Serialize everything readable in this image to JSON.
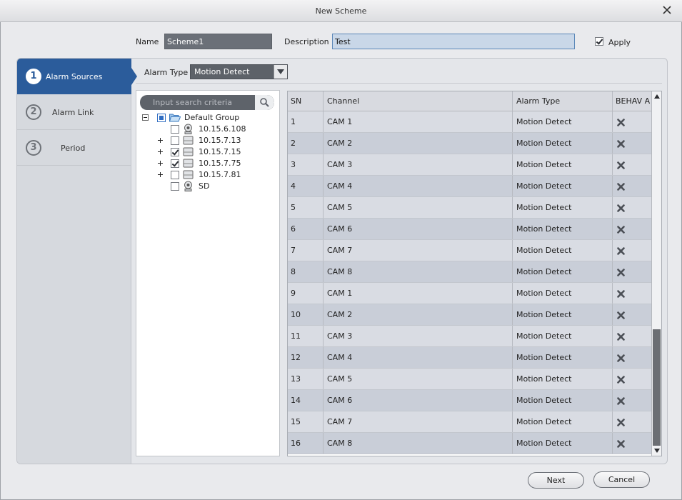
{
  "window": {
    "title": "New Scheme"
  },
  "form": {
    "name_label": "Name",
    "name_value": "Scheme1",
    "description_label": "Description",
    "description_value": "Test",
    "apply_label": "Apply",
    "apply_checked": true
  },
  "steps": [
    {
      "num": "1",
      "label": "Alarm Sources",
      "active": true
    },
    {
      "num": "2",
      "label": "Alarm Link",
      "active": false
    },
    {
      "num": "3",
      "label": "Period",
      "active": false
    }
  ],
  "alarm_type": {
    "label": "Alarm Type",
    "value": "Motion Detect"
  },
  "tree": {
    "search_placeholder": "Input search criteria",
    "group": "Default Group",
    "devices": [
      {
        "label": "10.15.6.108",
        "expandable": false,
        "checked": false,
        "icon": "camera-icon"
      },
      {
        "label": "10.15.7.13",
        "expandable": true,
        "checked": false,
        "icon": "nvr-device-icon"
      },
      {
        "label": "10.15.7.15",
        "expandable": true,
        "checked": true,
        "icon": "nvr-device-icon"
      },
      {
        "label": "10.15.7.75",
        "expandable": true,
        "checked": true,
        "icon": "nvr-device-icon"
      },
      {
        "label": "10.15.7.81",
        "expandable": true,
        "checked": false,
        "icon": "nvr-device-icon"
      },
      {
        "label": "SD",
        "expandable": false,
        "checked": false,
        "icon": "camera-icon"
      }
    ]
  },
  "table": {
    "columns": [
      "SN",
      "Channel",
      "Alarm Type",
      "BEHAV A"
    ],
    "rows": [
      [
        "1",
        "CAM 1",
        "Motion Detect"
      ],
      [
        "2",
        "CAM 2",
        "Motion Detect"
      ],
      [
        "3",
        "CAM 3",
        "Motion Detect"
      ],
      [
        "4",
        "CAM 4",
        "Motion Detect"
      ],
      [
        "5",
        "CAM 5",
        "Motion Detect"
      ],
      [
        "6",
        "CAM 6",
        "Motion Detect"
      ],
      [
        "7",
        "CAM 7",
        "Motion Detect"
      ],
      [
        "8",
        "CAM 8",
        "Motion Detect"
      ],
      [
        "9",
        "CAM 1",
        "Motion Detect"
      ],
      [
        "10",
        "CAM 2",
        "Motion Detect"
      ],
      [
        "11",
        "CAM 3",
        "Motion Detect"
      ],
      [
        "12",
        "CAM 4",
        "Motion Detect"
      ],
      [
        "13",
        "CAM 5",
        "Motion Detect"
      ],
      [
        "14",
        "CAM 6",
        "Motion Detect"
      ],
      [
        "15",
        "CAM 7",
        "Motion Detect"
      ],
      [
        "16",
        "CAM 8",
        "Motion Detect"
      ]
    ]
  },
  "buttons": {
    "next": "Next",
    "cancel": "Cancel"
  },
  "colors": {
    "accent": "#2b5c9b",
    "row_odd": "#d9dce3",
    "row_even": "#c9ced8"
  }
}
